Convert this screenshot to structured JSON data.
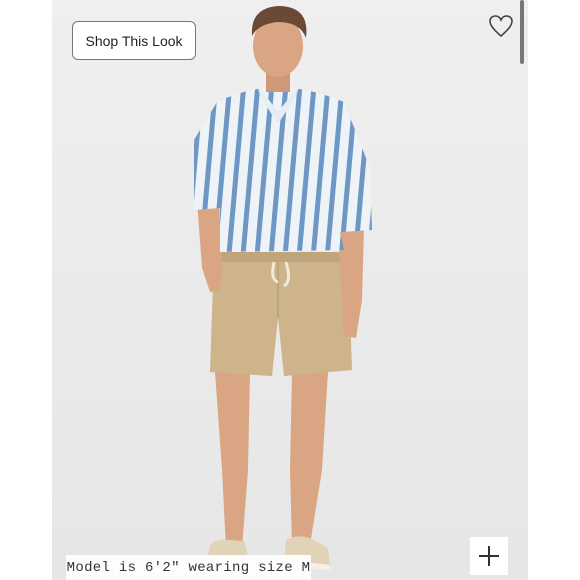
{
  "product_image": {
    "alt_subject": "model-photo",
    "background_color": "#ececec"
  },
  "overlay": {
    "shop_this_look_label": "Shop This Look",
    "caption": "Model is 6'2\" wearing size M"
  },
  "icons": {
    "favorite": "heart-icon",
    "zoom": "plus-icon"
  },
  "colors": {
    "shirt_stripe": "#6f97c4",
    "shirt_base": "#eef3f8",
    "shorts": "#cdb48a",
    "skin": "#d9a582",
    "hair": "#6a4a35",
    "shoes": "#e1d3b8"
  }
}
